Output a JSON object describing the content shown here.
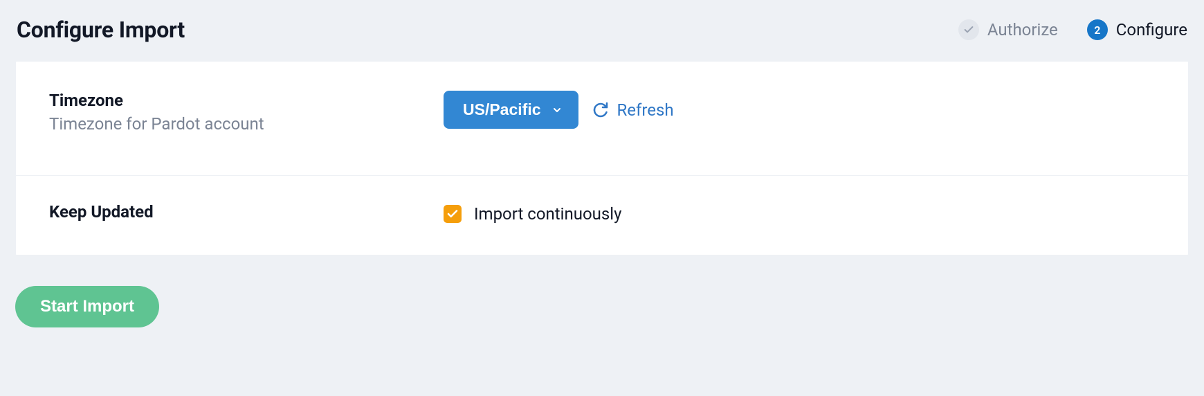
{
  "header": {
    "title": "Configure Import",
    "steps": {
      "authorize": {
        "label": "Authorize"
      },
      "configure": {
        "label": "Configure",
        "number": "2"
      }
    }
  },
  "sections": {
    "timezone": {
      "title": "Timezone",
      "subtitle": "Timezone for Pardot account",
      "selected": "US/Pacific",
      "refresh_label": "Refresh"
    },
    "keep_updated": {
      "title": "Keep Updated",
      "checkbox_label": "Import continuously"
    }
  },
  "actions": {
    "start_import": "Start Import"
  }
}
